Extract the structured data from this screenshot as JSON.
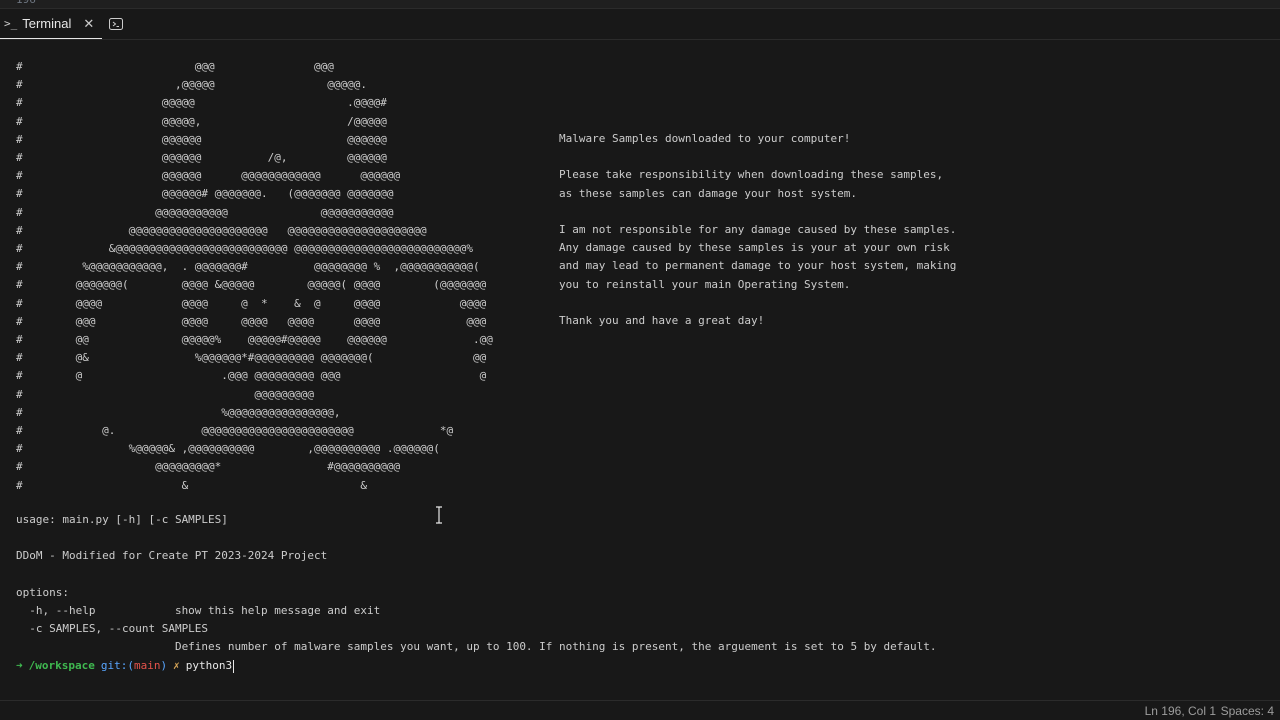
{
  "editor": {
    "line_number_partial": "196"
  },
  "panel": {
    "tab_title": "Terminal",
    "tab_glyph": ">_",
    "close_glyph": "✕",
    "icons": {
      "terminal": "terminal-icon",
      "close": "close-icon",
      "new_terminal": "new-terminal-icon"
    }
  },
  "terminal": {
    "ascii_art": [
      "#                          @@@               @@@",
      "#                       ,@@@@@                 @@@@@.",
      "#                     @@@@@                       .@@@@#",
      "#                     @@@@@,                      /@@@@@",
      "#                     @@@@@@                      @@@@@@",
      "#                     @@@@@@          /@,         @@@@@@",
      "#                     @@@@@@      @@@@@@@@@@@@      @@@@@@",
      "#                     @@@@@@# @@@@@@@.   (@@@@@@@ @@@@@@@",
      "#                    @@@@@@@@@@@              @@@@@@@@@@@",
      "#                @@@@@@@@@@@@@@@@@@@@@   @@@@@@@@@@@@@@@@@@@@@",
      "#             &@@@@@@@@@@@@@@@@@@@@@@@@@@ @@@@@@@@@@@@@@@@@@@@@@@@@@%",
      "#         %@@@@@@@@@@@,  . @@@@@@@#          @@@@@@@@ %  ,@@@@@@@@@@@(",
      "#        @@@@@@@(        @@@@ &@@@@@        @@@@@( @@@@        (@@@@@@@",
      "#        @@@@            @@@@     @  *    &  @     @@@@            @@@@",
      "#        @@@             @@@@     @@@@   @@@@      @@@@             @@@",
      "#        @@              @@@@@%    @@@@@#@@@@@    @@@@@@             .@@",
      "#        @&                %@@@@@@*#@@@@@@@@@ @@@@@@@(               @@",
      "#        @                     .@@@ @@@@@@@@@ @@@                     @",
      "#                                   @@@@@@@@@",
      "#                              %@@@@@@@@@@@@@@@@,",
      "#            @.             @@@@@@@@@@@@@@@@@@@@@@@             *@",
      "#                %@@@@@& ,@@@@@@@@@@        ,@@@@@@@@@@ .@@@@@@(",
      "#                    @@@@@@@@@*                #@@@@@@@@@@",
      "#                        &                          &"
    ],
    "message": [
      "Malware Samples downloaded to your computer!",
      "",
      "Please take responsibility when downloading these samples,",
      "as these samples can damage your host system.",
      "",
      "I am not responsible for any damage caused by these samples.",
      "Any damage caused by these samples is your at your own risk",
      "and may lead to permanent damage to your host system, making",
      "you to reinstall your main Operating System.",
      "",
      "Thank you and have a great day!"
    ],
    "usage": "usage: main.py [-h] [-c SAMPLES]",
    "description": "DDoM - Modified for Create PT 2023-2024 Project",
    "options_header": "options:",
    "option_help": "  -h, --help            show this help message and exit",
    "option_count": "  -c SAMPLES, --count SAMPLES",
    "option_count_desc": "                        Defines number of malware samples you want, up to 100. If nothing is present, the arguement is set to 5 by default.",
    "prompt": {
      "arrow": "➜",
      "dir": "/workspace",
      "git_label": "git:(",
      "branch": "main",
      "git_close": ")",
      "dirty_mark": "✗",
      "command": "python3"
    },
    "colors": {
      "prompt_green": "#3fb950",
      "git_blue": "#58a6ff",
      "branch_red": "#e5534b",
      "dirty_yellow": "#d8a657"
    }
  },
  "status_bar": {
    "position": "Ln 196, Col 1",
    "indent": "Spaces: 4"
  }
}
